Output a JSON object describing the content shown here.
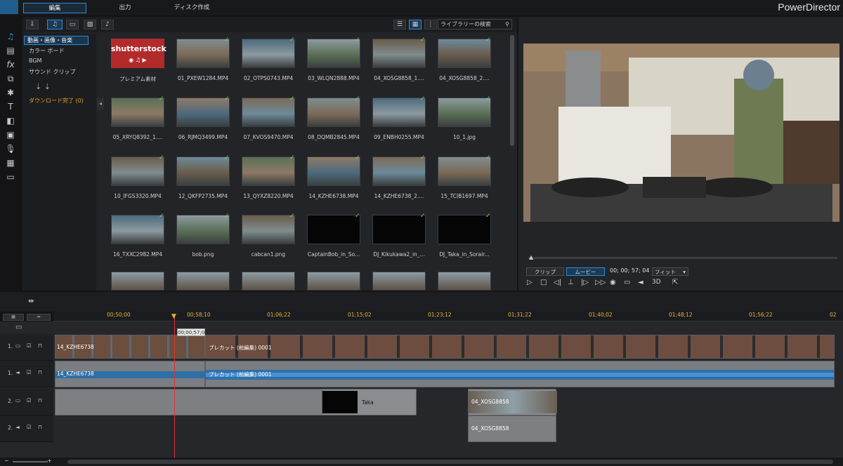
{
  "app": {
    "brand": "PowerDirector",
    "tabs": [
      "編集",
      "出力",
      "ディスク作成"
    ]
  },
  "library": {
    "search_placeholder": "ライブラリーの検索",
    "categories": [
      "動画・画像・音楽",
      "カラー ボード",
      "BGM",
      "サウンド クリップ"
    ],
    "download_status": "ダウンロード完了 (0)",
    "items": [
      {
        "label": "プレミアム素材",
        "kind": "shutterstock"
      },
      {
        "label": "01_PXEW1284.MP4",
        "kind": "video"
      },
      {
        "label": "02_OTPS0743.MP4",
        "kind": "video"
      },
      {
        "label": "03_WLQN2888.MP4",
        "kind": "video"
      },
      {
        "label": "04_XOSG8858_1....",
        "kind": "video"
      },
      {
        "label": "04_XOSG8858_2....",
        "kind": "video"
      },
      {
        "label": "05_XRYQ8392_1....",
        "kind": "video"
      },
      {
        "label": "06_RJMQ3499.MP4",
        "kind": "video"
      },
      {
        "label": "07_KVOS9470.MP4",
        "kind": "video"
      },
      {
        "label": "08_DQMB2845.MP4",
        "kind": "video"
      },
      {
        "label": "09_ENBH0255.MP4",
        "kind": "video"
      },
      {
        "label": "10_1.jpg",
        "kind": "image"
      },
      {
        "label": "10_IFGS3320.MP4",
        "kind": "video"
      },
      {
        "label": "12_QKFP2735.MP4",
        "kind": "video"
      },
      {
        "label": "13_QYXZ8220.MP4",
        "kind": "video"
      },
      {
        "label": "14_KZHE6738.MP4",
        "kind": "video"
      },
      {
        "label": "14_KZHE6738_2....",
        "kind": "video"
      },
      {
        "label": "15_TCIB1697.MP4",
        "kind": "video"
      },
      {
        "label": "16_TXXC2982.MP4",
        "kind": "video"
      },
      {
        "label": "bob.png",
        "kind": "image"
      },
      {
        "label": "cabcan1.png",
        "kind": "image"
      },
      {
        "label": "CaptainBob_in_So...",
        "kind": "black"
      },
      {
        "label": "DJ_Kikukawa2_in_...",
        "kind": "black"
      },
      {
        "label": "DJ_Taka_in_Sorair...",
        "kind": "black"
      }
    ],
    "shutterstock_text": "shutterstock"
  },
  "preview": {
    "mode_clip": "クリップ",
    "mode_movie": "ムービー",
    "timecode": "00; 00; 57; 04",
    "fit": "フィット",
    "mode_3d": "3D"
  },
  "timeline": {
    "ruler": [
      "00;50;00",
      "00;58;10",
      "01;06;22",
      "01;15;02",
      "01;23;12",
      "01;31;22",
      "01;40;02",
      "01;48;12",
      "01;56;22",
      "02"
    ],
    "playhead_time": "00;00;57;04",
    "tracks": [
      {
        "label": "1."
      },
      {
        "label": "1."
      },
      {
        "label": "2."
      },
      {
        "label": "2."
      }
    ],
    "clips": {
      "v1a": "14_KZHE6738",
      "v1b": "プレカット (前編集) 0001",
      "a1a": "14_KZHE6738",
      "a1b": "プレカット (前編集) 0001",
      "v2_taka": "Taka",
      "v2_xosg": "04_XOSG8858",
      "a2_xosg": "04_XOSG8858"
    }
  }
}
